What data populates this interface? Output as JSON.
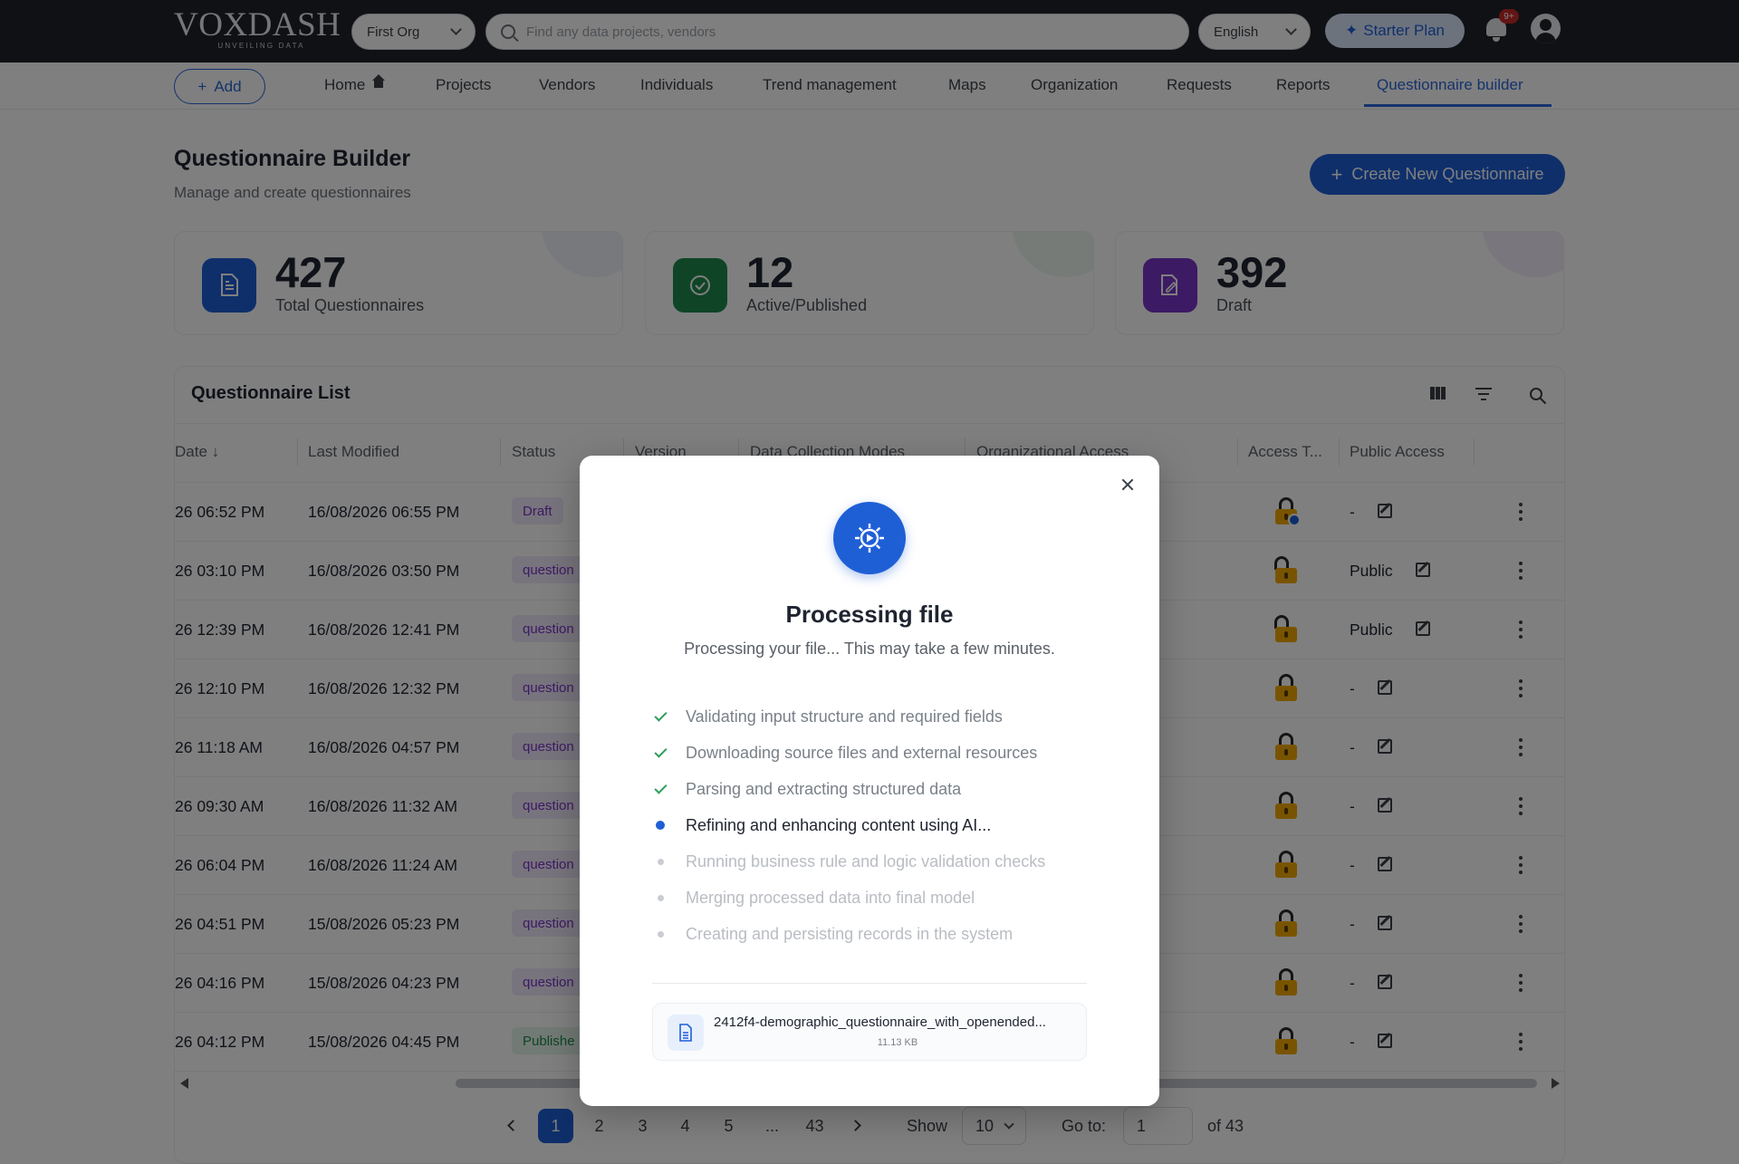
{
  "app": {
    "logo": "VoxDash",
    "tagline": "UNVEILING DATA"
  },
  "topbar": {
    "org": "First Org",
    "search_placeholder": "Find any data projects, vendors",
    "language": "English",
    "plan": "Starter Plan",
    "notifications_badge": "9+"
  },
  "nav": {
    "add_label": "Add",
    "items": [
      "Home",
      "Projects",
      "Vendors",
      "Individuals",
      "Trend management",
      "Maps",
      "Organization",
      "Requests",
      "Reports",
      "Questionnaire builder"
    ],
    "active": "Questionnaire builder"
  },
  "page": {
    "title": "Questionnaire Builder",
    "subtitle": "Manage and create questionnaires",
    "create_button": "Create New Questionnaire"
  },
  "stats": [
    {
      "value": "427",
      "label": "Total Questionnaires",
      "icon": "document-icon",
      "color": "#1f5fd6"
    },
    {
      "value": "12",
      "label": "Active/Published",
      "icon": "check-circle-icon",
      "color": "#1f8a4c"
    },
    {
      "value": "392",
      "label": "Draft",
      "icon": "edit-document-icon",
      "color": "#7b35c9"
    }
  ],
  "table": {
    "title": "Questionnaire List",
    "columns": [
      "Date",
      "Last Modified",
      "Status",
      "Version",
      "Data Collection Modes",
      "Organizational Access",
      "Access T...",
      "Public Access"
    ],
    "rows": [
      {
        "created": "26 06:52 PM",
        "modified": "16/08/2026 06:55 PM",
        "status": "Draft",
        "public": "-"
      },
      {
        "created": "26 03:10 PM",
        "modified": "16/08/2026 03:50 PM",
        "status": "question",
        "public": "Public"
      },
      {
        "created": "26 12:39 PM",
        "modified": "16/08/2026 12:41 PM",
        "status": "question",
        "public": "Public"
      },
      {
        "created": "26 12:10 PM",
        "modified": "16/08/2026 12:32 PM",
        "status": "question",
        "public": "-"
      },
      {
        "created": "26 11:18 AM",
        "modified": "16/08/2026 04:57 PM",
        "status": "question",
        "public": "-"
      },
      {
        "created": "26 09:30 AM",
        "modified": "16/08/2026 11:32 AM",
        "status": "question",
        "public": "-"
      },
      {
        "created": "26 06:04 PM",
        "modified": "16/08/2026 11:24 AM",
        "status": "question",
        "public": "-"
      },
      {
        "created": "26 04:51 PM",
        "modified": "15/08/2026 05:23 PM",
        "status": "question",
        "public": "-"
      },
      {
        "created": "26 04:16 PM",
        "modified": "15/08/2026 04:23 PM",
        "status": "question",
        "public": "-"
      },
      {
        "created": "26 04:12 PM",
        "modified": "15/08/2026 04:45 PM",
        "status": "Publishe",
        "public": "-"
      }
    ]
  },
  "pagination": {
    "pages": [
      "1",
      "2",
      "3",
      "4",
      "5",
      "...",
      "43"
    ],
    "current": "1",
    "show_label": "Show",
    "page_size": "10",
    "goto_label": "Go to:",
    "goto_value": "1",
    "total": "of 43"
  },
  "modal": {
    "title": "Processing file",
    "subtitle": "Processing your file... This may take a few minutes.",
    "steps": [
      {
        "label": "Validating input structure and required fields",
        "state": "done"
      },
      {
        "label": "Downloading source files and external resources",
        "state": "done"
      },
      {
        "label": "Parsing and extracting structured data",
        "state": "done"
      },
      {
        "label": "Refining and enhancing content using AI...",
        "state": "active"
      },
      {
        "label": "Running business rule and logic validation checks",
        "state": "pending"
      },
      {
        "label": "Merging processed data into final model",
        "state": "pending"
      },
      {
        "label": "Creating and persisting records in the system",
        "state": "pending"
      }
    ],
    "file": {
      "name": "2412f4-demographic_questionnaire_with_openended...",
      "size": "11.13 KB"
    }
  }
}
